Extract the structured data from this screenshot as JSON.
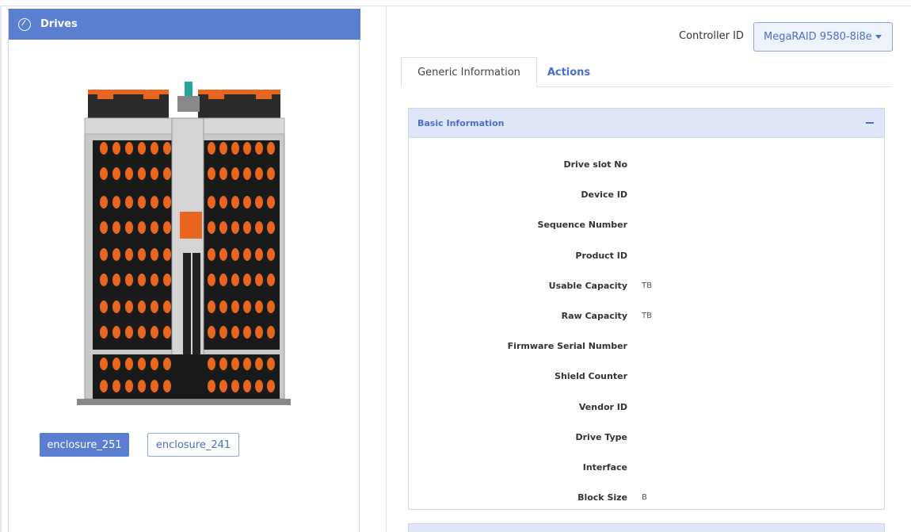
{
  "drives_panel": {
    "title": "Drives",
    "icon": "drives-icon"
  },
  "enclosures": [
    {
      "label": "enclosure_251",
      "active": true
    },
    {
      "label": "enclosure_241",
      "active": false
    }
  ],
  "controller": {
    "label": "Controller ID",
    "selected": "MegaRAID 9580-8i8e"
  },
  "tabs": [
    {
      "label": "Generic Information",
      "active": true
    },
    {
      "label": "Actions",
      "active": false
    }
  ],
  "basic_info": {
    "title": "Basic Information",
    "rows": [
      {
        "label": "Drive slot No",
        "value": ""
      },
      {
        "label": "Device ID",
        "value": ""
      },
      {
        "label": "Sequence Number",
        "value": ""
      },
      {
        "label": "Product ID",
        "value": ""
      },
      {
        "label": "Usable Capacity",
        "value": "TB"
      },
      {
        "label": "Raw Capacity",
        "value": "TB"
      },
      {
        "label": "Firmware Serial Number",
        "value": ""
      },
      {
        "label": "Shield Counter",
        "value": ""
      },
      {
        "label": "Vendor ID",
        "value": ""
      },
      {
        "label": "Drive Type",
        "value": ""
      },
      {
        "label": "Interface",
        "value": ""
      },
      {
        "label": "Block Size",
        "value": "B"
      }
    ]
  },
  "colors": {
    "accent": "#5a7fd1",
    "drive_orange": "#e8661f",
    "header_bg": "#dfe6f8"
  }
}
